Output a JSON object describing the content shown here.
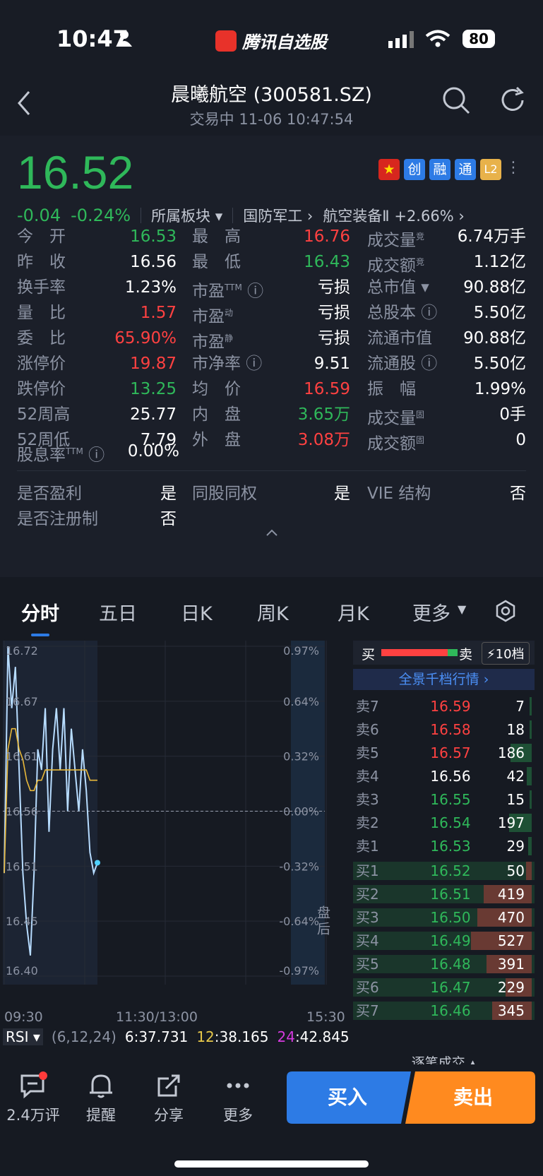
{
  "status": {
    "time": "10:47",
    "app_name": "腾讯自选股",
    "battery": "80"
  },
  "header": {
    "title": "晨曦航空 (300581.SZ)",
    "subtitle": "交易中   11-06 10:47:54"
  },
  "quote": {
    "price": "16.52",
    "change": "-0.04",
    "change_pct": "-0.24%",
    "sector_dropdown": "所属板块",
    "sector1": "国防军工",
    "sector2": "航空装备Ⅱ",
    "sector2_change": "+2.66%",
    "tags": [
      "创",
      "融",
      "通",
      "L2"
    ],
    "col1": [
      {
        "label": "今　开",
        "value": "16.53",
        "color": "green"
      },
      {
        "label": "昨　收",
        "value": "16.56",
        "color": "white"
      },
      {
        "label": "换手率",
        "value": "1.23%",
        "color": "white"
      },
      {
        "label": "量　比",
        "value": "1.57",
        "color": "red"
      },
      {
        "label": "委　比",
        "value": "65.90%",
        "color": "red"
      },
      {
        "label": "涨停价",
        "value": "19.87",
        "color": "red"
      },
      {
        "label": "跌停价",
        "value": "13.25",
        "color": "green"
      },
      {
        "label": "52周高",
        "value": "25.77",
        "color": "white"
      },
      {
        "label": "52周低",
        "value": "7.79",
        "color": "white"
      }
    ],
    "col2": [
      {
        "label": "最　高",
        "value": "16.76",
        "color": "red"
      },
      {
        "label": "最　低",
        "value": "16.43",
        "color": "green"
      },
      {
        "label": "市盈TTM",
        "value": "亏损",
        "color": "white"
      },
      {
        "label": "市盈动",
        "value": "亏损",
        "color": "white"
      },
      {
        "label": "市盈静",
        "value": "亏损",
        "color": "white"
      },
      {
        "label": "市净率",
        "value": "9.51",
        "color": "white"
      },
      {
        "label": "均　价",
        "value": "16.59",
        "color": "red"
      },
      {
        "label": "内　盘",
        "value": "3.65万",
        "color": "green"
      },
      {
        "label": "外　盘",
        "value": "3.08万",
        "color": "red"
      }
    ],
    "col3": [
      {
        "label": "成交量竞",
        "value": "6.74万手",
        "color": "white"
      },
      {
        "label": "成交额竞",
        "value": "1.12亿",
        "color": "white"
      },
      {
        "label": "总市值",
        "value": "90.88亿",
        "color": "white"
      },
      {
        "label": "总股本",
        "value": "5.50亿",
        "color": "white"
      },
      {
        "label": "流通市值",
        "value": "90.88亿",
        "color": "white"
      },
      {
        "label": "流通股",
        "value": "5.50亿",
        "color": "white"
      },
      {
        "label": "振　幅",
        "value": "1.99%",
        "color": "white"
      },
      {
        "label": "成交量固",
        "value": "0手",
        "color": "white"
      },
      {
        "label": "成交额固",
        "value": "0",
        "color": "white"
      }
    ],
    "dividend_label": "股息率TTM",
    "dividend_value": "0.00%",
    "flags": [
      {
        "label": "是否盈利",
        "value": "是"
      },
      {
        "label": "同股同权",
        "value": "是"
      },
      {
        "label": "VIE 结构",
        "value": "否"
      },
      {
        "label": "是否注册制",
        "value": "否"
      }
    ]
  },
  "tabs": [
    "分时",
    "五日",
    "日K",
    "周K",
    "月K",
    "更多"
  ],
  "chart_data": {
    "type": "line",
    "title": "",
    "ylim": [
      16.4,
      16.72
    ],
    "y_ticks_left": [
      "16.72",
      "16.67",
      "16.61",
      "16.56",
      "16.51",
      "16.45",
      "16.40"
    ],
    "y_ticks_right": [
      "0.97%",
      "0.64%",
      "0.32%",
      "0.00%",
      "-0.32%",
      "-0.64%",
      "-0.97%"
    ],
    "x_ticks": [
      "09:30",
      "11:30/13:00",
      "15:30"
    ],
    "prev_close": 16.56,
    "series": [
      {
        "values": [
          16.5,
          16.72,
          16.66,
          16.7,
          16.6,
          16.5,
          16.45,
          16.42,
          16.5,
          16.62,
          16.6,
          16.66,
          16.54,
          16.62,
          16.66,
          16.6,
          16.66,
          16.56,
          16.64,
          16.6,
          16.56,
          16.62,
          16.58,
          16.52,
          16.5,
          16.51
        ]
      },
      {
        "values": [
          16.5,
          16.62,
          16.64,
          16.64,
          16.62,
          16.61,
          16.59,
          16.58,
          16.58,
          16.59,
          16.59,
          16.6,
          16.6,
          16.6,
          16.6,
          16.6,
          16.6,
          16.6,
          16.6,
          16.6,
          16.6,
          16.6,
          16.6,
          16.59,
          16.59,
          16.59
        ]
      }
    ],
    "after_hours_label": "盘后"
  },
  "rsi": {
    "label": "RSI",
    "params": "(6,12,24)",
    "rsi6_label": "6",
    "rsi6": ":37.731",
    "rsi12_label": "12",
    "rsi12": ":38.165",
    "rsi24_label": "24",
    "rsi24": ":42.845"
  },
  "orderbook": {
    "buy_label": "买",
    "sell_label": "卖",
    "depth_btn": "10档",
    "full_view": "全景千档行情",
    "asks": [
      {
        "label": "卖7",
        "price": "16.59",
        "vol": "7",
        "color": "red"
      },
      {
        "label": "卖6",
        "price": "16.58",
        "vol": "18",
        "color": "red"
      },
      {
        "label": "卖5",
        "price": "16.57",
        "vol": "186",
        "color": "red"
      },
      {
        "label": "卖4",
        "price": "16.56",
        "vol": "42",
        "color": "white"
      },
      {
        "label": "卖3",
        "price": "16.55",
        "vol": "15",
        "color": "green"
      },
      {
        "label": "卖2",
        "price": "16.54",
        "vol": "197",
        "color": "green"
      },
      {
        "label": "卖1",
        "price": "16.53",
        "vol": "29",
        "color": "green"
      }
    ],
    "bids": [
      {
        "label": "买1",
        "price": "16.52",
        "vol": "50",
        "color": "green"
      },
      {
        "label": "买2",
        "price": "16.51",
        "vol": "419",
        "color": "green"
      },
      {
        "label": "买3",
        "price": "16.50",
        "vol": "470",
        "color": "green"
      },
      {
        "label": "买4",
        "price": "16.49",
        "vol": "527",
        "color": "green"
      },
      {
        "label": "买5",
        "price": "16.48",
        "vol": "391",
        "color": "green"
      },
      {
        "label": "买6",
        "price": "16.47",
        "vol": "229",
        "color": "green"
      },
      {
        "label": "买7",
        "price": "16.46",
        "vol": "345",
        "color": "green"
      }
    ],
    "footer": "逐笔成交"
  },
  "bottom": {
    "comments": "2.4万评",
    "alert": "提醒",
    "share": "分享",
    "more": "更多",
    "buy": "买入",
    "sell": "卖出"
  }
}
